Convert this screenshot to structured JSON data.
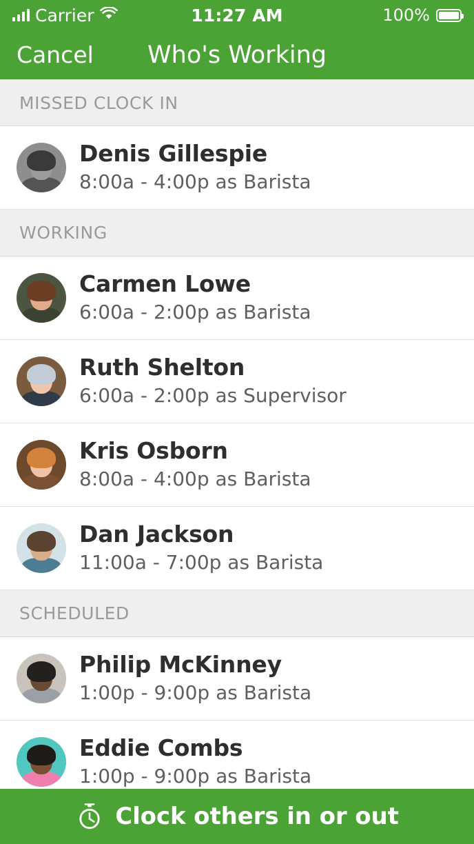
{
  "status_bar": {
    "carrier": "Carrier",
    "signal_icon": "signal-bars-icon",
    "wifi_icon": "wifi-icon",
    "time": "11:27 AM",
    "battery_percent": "100%",
    "battery_icon": "battery-full-icon"
  },
  "nav_bar": {
    "cancel_label": "Cancel",
    "title": "Who's Working"
  },
  "colors": {
    "brand_green": "#4ba335",
    "section_header_bg": "#efeff0",
    "section_header_text": "#9a9a9a",
    "row_bg": "#ffffff",
    "name_text": "#2e2e2e",
    "detail_text": "#5f5f5f"
  },
  "sections": [
    {
      "title": "MISSED CLOCK IN",
      "people": [
        {
          "name": "Denis Gillespie",
          "detail": "8:00a - 4:00p as Barista",
          "avatar": {
            "bg": "#8e8e8e",
            "hair": "#3a3a3a",
            "skin": "#9c9c9c",
            "body": "#545454"
          }
        }
      ]
    },
    {
      "title": "WORKING",
      "people": [
        {
          "name": "Carmen Lowe",
          "detail": "6:00a - 2:00p as Barista",
          "avatar": {
            "bg": "#4c5540",
            "hair": "#6b3d22",
            "skin": "#e2ab8c",
            "body": "#3b4433"
          }
        },
        {
          "name": "Ruth Shelton",
          "detail": "6:00a - 2:00p as Supervisor",
          "avatar": {
            "bg": "#7a5b3e",
            "hair": "#c3cdd8",
            "skin": "#efc6ab",
            "body": "#2f3b49"
          }
        },
        {
          "name": "Kris Osborn",
          "detail": "8:00a - 4:00p as Barista",
          "avatar": {
            "bg": "#6d4a2b",
            "hair": "#d4833c",
            "skin": "#f0c3a6",
            "body": "#7a5232"
          }
        },
        {
          "name": "Dan Jackson",
          "detail": "11:00a - 7:00p as Barista",
          "avatar": {
            "bg": "#d3e2e6",
            "hair": "#5a4331",
            "skin": "#d9ae8c",
            "body": "#4d7d93"
          }
        }
      ]
    },
    {
      "title": "SCHEDULED",
      "people": [
        {
          "name": "Philip McKinney",
          "detail": "1:00p - 9:00p as Barista",
          "avatar": {
            "bg": "#c8c4bb",
            "hair": "#22201e",
            "skin": "#6a4a35",
            "body": "#9aa0a6"
          }
        },
        {
          "name": "Eddie Combs",
          "detail": "1:00p - 9:00p as Barista",
          "avatar": {
            "bg": "#52c7c0",
            "hair": "#1d1a18",
            "skin": "#7a4f33",
            "body": "#ef7fae"
          }
        }
      ]
    }
  ],
  "bottom_action": {
    "label": "Clock others in or out",
    "icon": "stopwatch-icon"
  }
}
